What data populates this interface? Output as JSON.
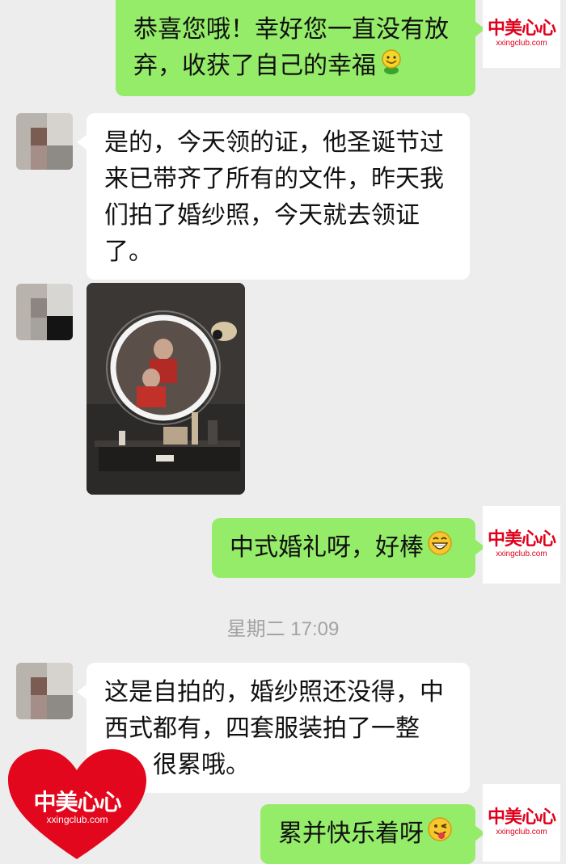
{
  "brand": {
    "name": "中美心心",
    "url": "xxingclub.com"
  },
  "colors": {
    "bubble_out": "#95ec69",
    "bubble_in": "#ffffff",
    "background": "#ededed",
    "brand_red": "#e0001b"
  },
  "messages": [
    {
      "side": "out",
      "text": "恭喜您哦！幸好您一直没有放弃，收获了自己的幸福",
      "emoji": "smile-face-emoji"
    },
    {
      "side": "in",
      "text": "是的，今天领的证，他圣诞节过来已带齐了所有的文件，昨天我们拍了婚纱照，今天就去领证了。"
    },
    {
      "side": "in",
      "type": "image"
    },
    {
      "side": "out",
      "text": "中式婚礼呀，好棒",
      "emoji": "grin-face-emoji"
    },
    {
      "side": "in",
      "text": "这是自拍的，婚纱照还没得，中西式都有，四套服装拍了一整天，很累哦。"
    },
    {
      "side": "out",
      "text": "累并快乐着呀",
      "emoji": "wink-tongue-emoji"
    }
  ],
  "timestamp": "星期二 17:09"
}
